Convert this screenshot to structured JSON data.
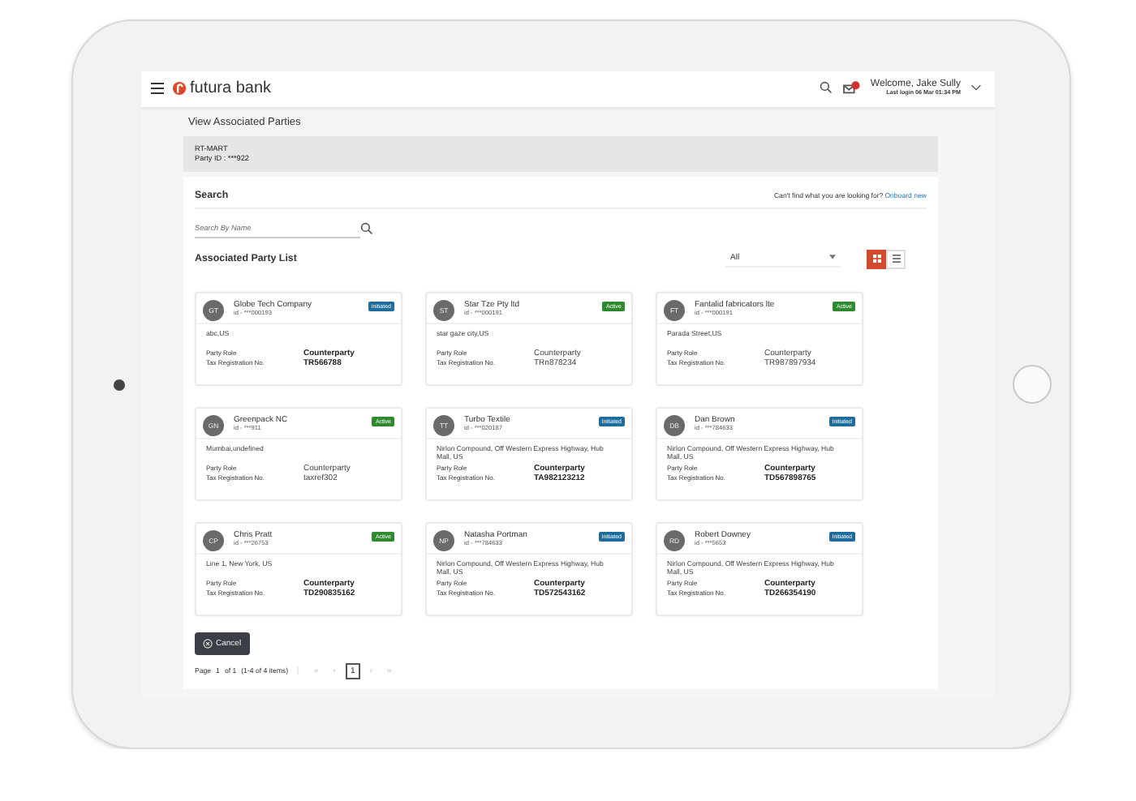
{
  "header": {
    "logo": "futura bank",
    "welcome": "Welcome, Jake Sully",
    "last_login": "Last login 06 Mar 01:34 PM"
  },
  "page_title": "View Associated Parties",
  "party": {
    "name": "RT-MART",
    "party_id": "Party ID : ***922"
  },
  "search": {
    "title": "Search",
    "hint": "Can't find what you are looking for?",
    "link": "Onboard new",
    "placeholder": "Search By Name"
  },
  "list": {
    "title": "Associated Party List",
    "filter": "All",
    "views": [
      {
        "kind": "grid",
        "selected": true
      },
      {
        "kind": "list",
        "selected": false
      }
    ]
  },
  "cards": [
    {
      "initials": "GT",
      "name": "Globe Tech Company",
      "id": "id - ***000193",
      "status": "Initiated",
      "kind": "initiated",
      "address": "abc,US",
      "role_label": "Party Role",
      "role": "Counterparty",
      "tax_label": "Tax Registration No.",
      "tax": "TR566788",
      "bold": true
    },
    {
      "initials": "ST",
      "name": "Star Tze Pty ltd",
      "id": "id - ***000191",
      "status": "Active",
      "kind": "active",
      "address": "star gaze city,US",
      "role_label": "Party Role",
      "role": "Counterparty",
      "tax_label": "Tax Registration No.",
      "tax": "TRn878234",
      "bold": false
    },
    {
      "initials": "FT",
      "name": "Fantalid fabricators lte",
      "id": "id - ***000191",
      "status": "Active",
      "kind": "active",
      "address": "Parada Street,US",
      "role_label": "Party Role",
      "role": "Counterparty",
      "tax_label": "Tax Registration No.",
      "tax": "TR987897934",
      "bold": false
    },
    {
      "initials": "GN",
      "name": "Greenpack NC",
      "id": "id - ***911",
      "status": "Active",
      "kind": "active",
      "address": "Mumbai,undefined",
      "role_label": "Party Role",
      "role": "Counterparty",
      "tax_label": "Tax Registration No.",
      "tax": "taxref302",
      "bold": false
    },
    {
      "initials": "TT",
      "name": "Turbo Textile",
      "id": "id - ***020187",
      "status": "Initiated",
      "kind": "initiated",
      "address": "Nirlon Compound, Off Western Express Highway, Hub Mall, US",
      "role_label": "Party Role",
      "role": "Counterparty",
      "tax_label": "Tax Registration No.",
      "tax": "TA982123212",
      "bold": true
    },
    {
      "initials": "DB",
      "name": "Dan Brown",
      "id": "id - ***784633",
      "status": "Initiated",
      "kind": "initiated",
      "address": "Nirlon Compound, Off Western Express Highway, Hub Mall, US",
      "role_label": "Party Role",
      "role": "Counterparty",
      "tax_label": "Tax Registration No.",
      "tax": "TD567898765",
      "bold": true
    },
    {
      "initials": "CP",
      "name": "Chris Pratt",
      "id": "id - ***26753",
      "status": "Active",
      "kind": "active",
      "address": "Line 1, New York, US",
      "role_label": "Party Role",
      "role": "Counterparty",
      "tax_label": "Tax Registration No.",
      "tax": "TD290835162",
      "bold": true
    },
    {
      "initials": "NP",
      "name": "Natasha Portman",
      "id": "id - ***784633",
      "status": "Initiated",
      "kind": "initiated",
      "address": "Nirlon Compound, Off Western Express Highway, Hub Mall, US",
      "role_label": "Party Role",
      "role": "Counterparty",
      "tax_label": "Tax Registration No.",
      "tax": "TD572543162",
      "bold": true
    },
    {
      "initials": "RD",
      "name": "Robert Downey",
      "id": "id - ***5653",
      "status": "Initiated",
      "kind": "initiated",
      "address": "Nirlon Compound, Off Western Express Highway, Hub Mall, US",
      "role_label": "Party Role",
      "role": "Counterparty",
      "tax_label": "Tax Registration No.",
      "tax": "TD266354190",
      "bold": true
    }
  ],
  "cancel": "Cancel",
  "pagination": {
    "page_label": "Page",
    "page": "1",
    "of": "of 1",
    "range": "(1-4 of 4 items)",
    "first": "«",
    "prev": "‹",
    "current": "1",
    "next": "›",
    "last": "»"
  }
}
